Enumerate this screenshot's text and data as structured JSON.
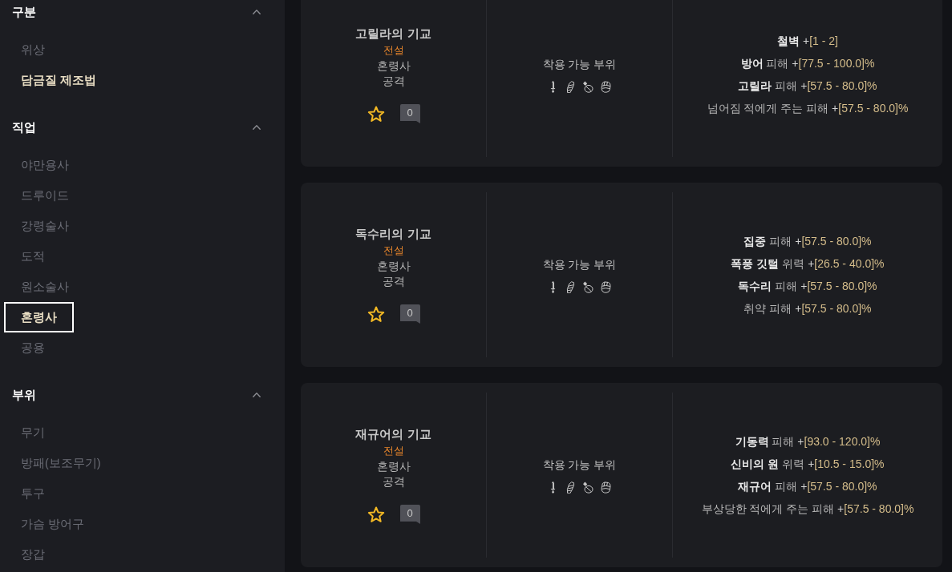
{
  "sidebar": {
    "sections": [
      {
        "title": "구분",
        "expanded": true,
        "items": [
          {
            "label": "위상",
            "selected": false,
            "focused": false
          },
          {
            "label": "담금질 제조법",
            "selected": true,
            "focused": false
          }
        ]
      },
      {
        "title": "직업",
        "expanded": true,
        "items": [
          {
            "label": "야만용사",
            "selected": false,
            "focused": false
          },
          {
            "label": "드루이드",
            "selected": false,
            "focused": false
          },
          {
            "label": "강령술사",
            "selected": false,
            "focused": false
          },
          {
            "label": "도적",
            "selected": false,
            "focused": false
          },
          {
            "label": "원소술사",
            "selected": false,
            "focused": false
          },
          {
            "label": "혼령사",
            "selected": true,
            "focused": true
          },
          {
            "label": "공용",
            "selected": false,
            "focused": false
          }
        ]
      },
      {
        "title": "부위",
        "expanded": true,
        "items": [
          {
            "label": "무기",
            "selected": false,
            "focused": false
          },
          {
            "label": "방패(보조무기)",
            "selected": false,
            "focused": false
          },
          {
            "label": "투구",
            "selected": false,
            "focused": false
          },
          {
            "label": "가슴 방어구",
            "selected": false,
            "focused": false
          },
          {
            "label": "장갑",
            "selected": false,
            "focused": false
          }
        ]
      }
    ]
  },
  "recipes": [
    {
      "name": "고릴라의 기교",
      "rarity": "전설",
      "class": "혼령사",
      "type": "공격",
      "favorite": false,
      "comments": "0",
      "slots_label": "착용 가능 부위",
      "stats": [
        {
          "name": "철벽",
          "sign": "+",
          "range": "[1 - 2]"
        },
        {
          "name": "방어",
          "label": "피해",
          "sign": "+",
          "range": "[77.5 - 100.0]%"
        },
        {
          "name": "고릴라",
          "label": "피해",
          "sign": "+",
          "range": "[57.5 - 80.0]%"
        },
        {
          "label": "넘어짐 적에게 주는 피해",
          "sign": "+",
          "range": "[57.5 - 80.0]%"
        }
      ]
    },
    {
      "name": "독수리의 기교",
      "rarity": "전설",
      "class": "혼령사",
      "type": "공격",
      "favorite": false,
      "comments": "0",
      "slots_label": "착용 가능 부위",
      "stats": [
        {
          "name": "집중",
          "label": "피해",
          "sign": "+",
          "range": "[57.5 - 80.0]%"
        },
        {
          "name": "폭풍 깃털",
          "label": "위력",
          "sign": "+",
          "range": "[26.5 - 40.0]%"
        },
        {
          "name": "독수리",
          "label": "피해",
          "sign": "+",
          "range": "[57.5 - 80.0]%"
        },
        {
          "label": "취약 피해",
          "sign": "+",
          "range": "[57.5 - 80.0]%"
        }
      ]
    },
    {
      "name": "재규어의 기교",
      "rarity": "전설",
      "class": "혼령사",
      "type": "공격",
      "favorite": false,
      "comments": "0",
      "slots_label": "착용 가능 부위",
      "stats": [
        {
          "name": "기동력",
          "label": "피해",
          "sign": "+",
          "range": "[93.0 - 120.0]%"
        },
        {
          "name": "신비의 원",
          "label": "위력",
          "sign": "+",
          "range": "[10.5 - 15.0]%"
        },
        {
          "name": "재규어",
          "label": "피해",
          "sign": "+",
          "range": "[57.5 - 80.0]%"
        },
        {
          "label": "부상당한 적에게 주는 피해",
          "sign": "+",
          "range": "[57.5 - 80.0]%"
        }
      ]
    }
  ]
}
